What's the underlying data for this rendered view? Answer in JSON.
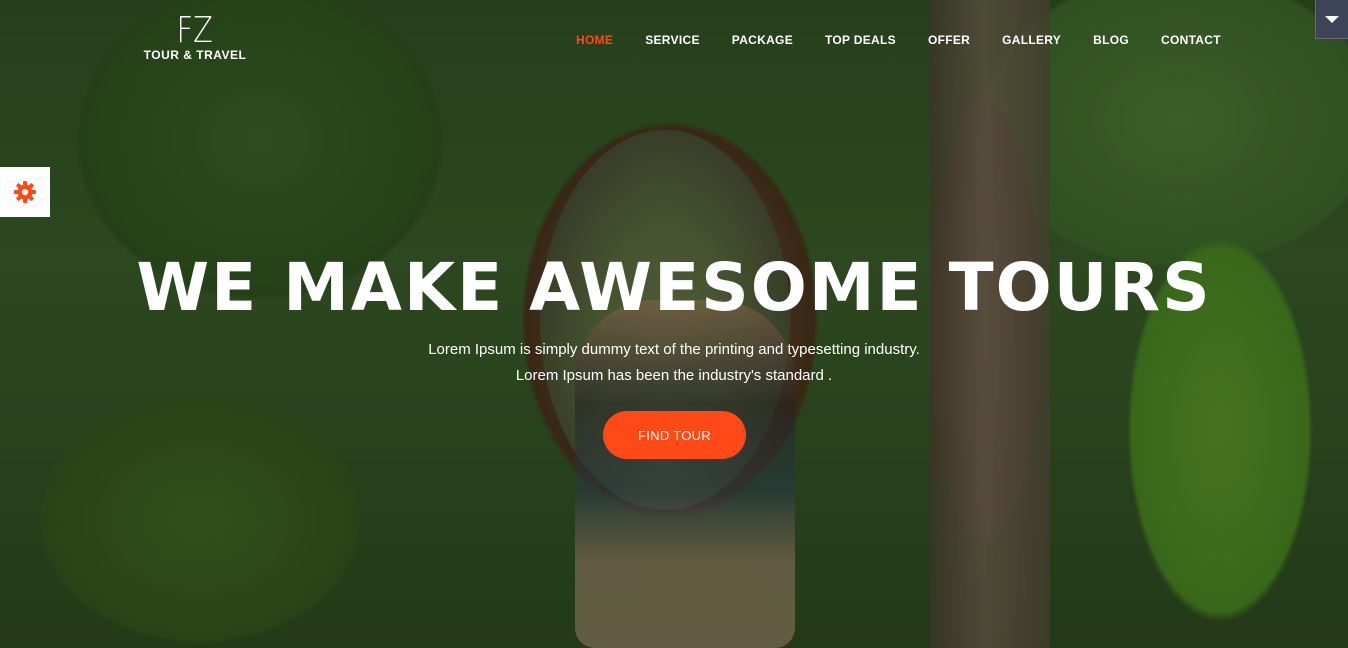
{
  "brand": {
    "mark": "FZ",
    "tagline": "TOUR & TRAVEL"
  },
  "nav": {
    "items": [
      {
        "label": "HOME",
        "active": true
      },
      {
        "label": "SERVICE",
        "active": false
      },
      {
        "label": "PACKAGE",
        "active": false
      },
      {
        "label": "TOP DEALS",
        "active": false
      },
      {
        "label": "OFFER",
        "active": false
      },
      {
        "label": "GALLERY",
        "active": false
      },
      {
        "label": "BLOG",
        "active": false
      },
      {
        "label": "CONTACT",
        "active": false
      }
    ]
  },
  "hero": {
    "title": "WE MAKE AWESOME TOURS",
    "subtitle_line1": "Lorem Ipsum is simply dummy text of the printing and typesetting industry.",
    "subtitle_line2": "Lorem Ipsum has been the industry's standard .",
    "cta_label": "FIND TOUR"
  },
  "widgets": {
    "settings_icon": "gear-icon",
    "corner_toggle_icon": "caret-down-icon"
  },
  "colors": {
    "accent": "#ff4a17",
    "nav_text": "#ffffff",
    "corner_toggle_bg": "#3d4458"
  }
}
